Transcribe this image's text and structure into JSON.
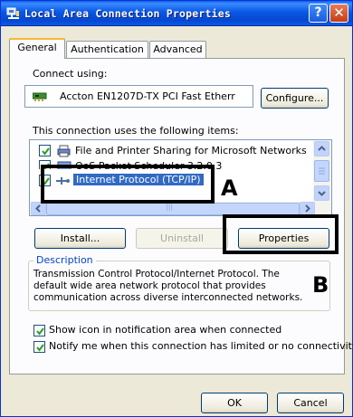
{
  "window": {
    "title": "Local Area Connection Properties",
    "help_label": "?",
    "close_label": "✕"
  },
  "tabs": [
    {
      "label": "General",
      "active": true
    },
    {
      "label": "Authentication",
      "active": false
    },
    {
      "label": "Advanced",
      "active": false
    }
  ],
  "general": {
    "connect_using_label": "Connect using:",
    "adapter_name": "Accton EN1207D-TX PCI Fast Etherr",
    "configure_button": "Configure...",
    "items_label": "This connection uses the following items:",
    "items": [
      {
        "label": "File and Printer Sharing for Microsoft Networks",
        "checked": true,
        "selected": false,
        "icon": "printer-sharing-icon"
      },
      {
        "label": "QoS Packet Scheduler 3.2.0.3",
        "checked": true,
        "selected": false,
        "icon": "scheduler-icon"
      },
      {
        "label": "Internet Protocol (TCP/IP)",
        "checked": true,
        "selected": true,
        "icon": "protocol-icon"
      }
    ],
    "scroll_grip": "|||",
    "install_button": "Install...",
    "uninstall_button": "Uninstall",
    "properties_button": "Properties",
    "description_legend": "Description",
    "description_text": "Transmission Control Protocol/Internet Protocol. The default wide area network protocol that provides communication across diverse interconnected networks.",
    "show_icon_label": "Show icon in notification area when connected",
    "show_icon_checked": true,
    "notify_label": "Notify me when this connection has limited or no connectivity",
    "notify_checked": true
  },
  "footer": {
    "ok_button": "OK",
    "cancel_button": "Cancel"
  },
  "annotations": {
    "a_label": "A",
    "b_label": "B"
  },
  "colors": {
    "titlebar": "#0a58e4",
    "selection": "#316ac5",
    "panel": "#fcfcfe",
    "frame": "#ece9d8"
  }
}
